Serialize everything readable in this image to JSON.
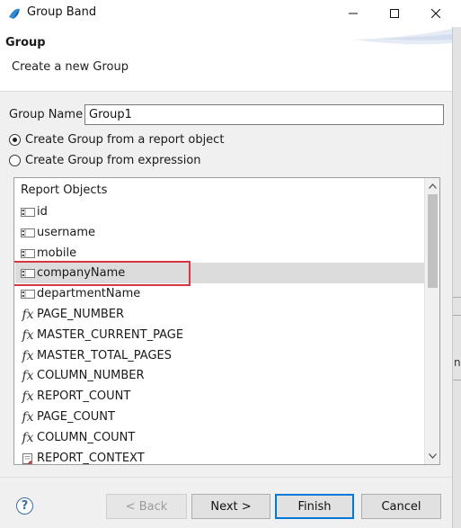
{
  "window": {
    "title": "Group Band",
    "minimize_icon": "minimize-icon",
    "maximize_icon": "maximize-icon",
    "close_icon": "close-icon"
  },
  "banner": {
    "title": "Group",
    "description": "Create a new Group"
  },
  "form": {
    "group_name_label": "Group Name",
    "group_name_value": "Group1",
    "radio_report_object": "Create Group from a report object",
    "radio_expression": "Create Group from expression",
    "selected_radio": "report_object"
  },
  "report_objects": {
    "header": "Report Objects",
    "selected": "companyName",
    "items": [
      {
        "label": "id",
        "icon": "column-icon"
      },
      {
        "label": "username",
        "icon": "column-icon"
      },
      {
        "label": "mobile",
        "icon": "column-icon"
      },
      {
        "label": "companyName",
        "icon": "column-icon"
      },
      {
        "label": "departmentName",
        "icon": "column-icon"
      },
      {
        "label": "PAGE_NUMBER",
        "icon": "fx-icon"
      },
      {
        "label": "MASTER_CURRENT_PAGE",
        "icon": "fx-icon"
      },
      {
        "label": "MASTER_TOTAL_PAGES",
        "icon": "fx-icon"
      },
      {
        "label": "COLUMN_NUMBER",
        "icon": "fx-icon"
      },
      {
        "label": "REPORT_COUNT",
        "icon": "fx-icon"
      },
      {
        "label": "PAGE_COUNT",
        "icon": "fx-icon"
      },
      {
        "label": "COLUMN_COUNT",
        "icon": "fx-icon"
      },
      {
        "label": "REPORT_CONTEXT",
        "icon": "report-context-icon"
      }
    ]
  },
  "buttons": {
    "back": "< Back",
    "next": "Next >",
    "finish": "Finish",
    "cancel": "Cancel"
  },
  "background": {
    "partial_text": "ny"
  },
  "colors": {
    "highlight_border": "#d9363e",
    "selected_row": "#dcdcdc",
    "default_button_border": "#0078d7"
  }
}
